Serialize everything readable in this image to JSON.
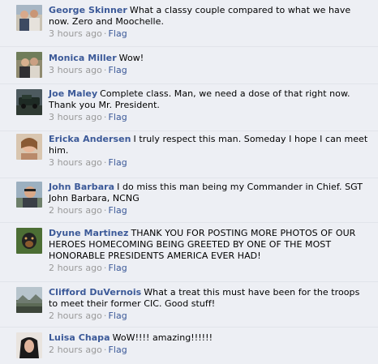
{
  "comments": [
    {
      "author": "George Skinner",
      "text": "What a classy couple compared to what we have now. Zero and Moochelle.",
      "time": "3 hours ago",
      "action": "Flag",
      "avatar_icon": "avatar-couple-photo"
    },
    {
      "author": "Monica Miller",
      "text": "Wow!",
      "time": "3 hours ago",
      "action": "Flag",
      "avatar_icon": "avatar-couple-photo"
    },
    {
      "author": "Joe Maley",
      "text": "Complete class. Man, we need a dose of that right now. Thank you Mr. President.",
      "time": "3 hours ago",
      "action": "Flag",
      "avatar_icon": "avatar-vehicle-photo"
    },
    {
      "author": "Ericka Andersen",
      "text": "I truly respect this man. Someday I hope I can meet him.",
      "time": "3 hours ago",
      "action": "Flag",
      "avatar_icon": "avatar-person-photo"
    },
    {
      "author": "John Barbara",
      "text": "I do miss this man being my Commander in Chief. SGT John Barbara, NCNG",
      "time": "2 hours ago",
      "action": "Flag",
      "avatar_icon": "avatar-person-photo"
    },
    {
      "author": "Dyune Martinez",
      "text": "THANK YOU FOR POSTING MORE PHOTOS OF OUR HEROES HOMECOMING BEING GREETED BY ONE OF THE MOST HONORABLE PRESIDENTS AMERICA EVER HAD!",
      "time": "2 hours ago",
      "action": "Flag",
      "avatar_icon": "avatar-dog-photo"
    },
    {
      "author": "Clifford DuVernois",
      "text": "What a treat this must have been for the troops to meet their former CIC. Good stuff!",
      "time": "2 hours ago",
      "action": "Flag",
      "avatar_icon": "avatar-landscape-photo"
    },
    {
      "author": "Luisa Chapa",
      "text": "WoW!!!! amazing!!!!!!",
      "time": "2 hours ago",
      "action": "Flag",
      "avatar_icon": "avatar-person-photo"
    }
  ],
  "meta_separator": "·"
}
